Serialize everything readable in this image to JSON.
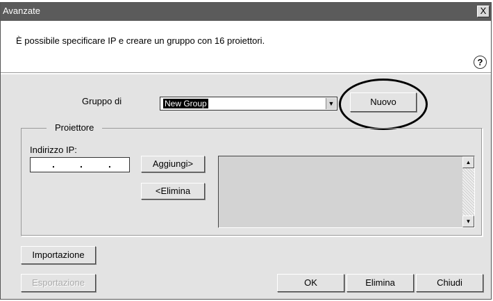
{
  "window": {
    "title": "Avanzate",
    "close_label": "X"
  },
  "description": "È possibile specificare IP e creare un gruppo con 16 proiettori.",
  "help_label": "?",
  "group": {
    "label": "Gruppo di",
    "value": "New Group",
    "new_button": "Nuovo"
  },
  "projector": {
    "section_title": "Proiettore",
    "ip_label": "Indirizzo IP:",
    "ip_dots": [
      ".",
      ".",
      "."
    ],
    "add_button": "Aggiungi>",
    "remove_button": "<Elimina"
  },
  "footer": {
    "import_button": "Importazione",
    "export_button": "Esportazione",
    "ok_button": "OK",
    "delete_button": "Elimina",
    "close_button": "Chiudi"
  },
  "icons": {
    "dropdown": "triangle-down",
    "scroll_up": "triangle-up",
    "scroll_down": "triangle-down",
    "help": "question-circle"
  }
}
